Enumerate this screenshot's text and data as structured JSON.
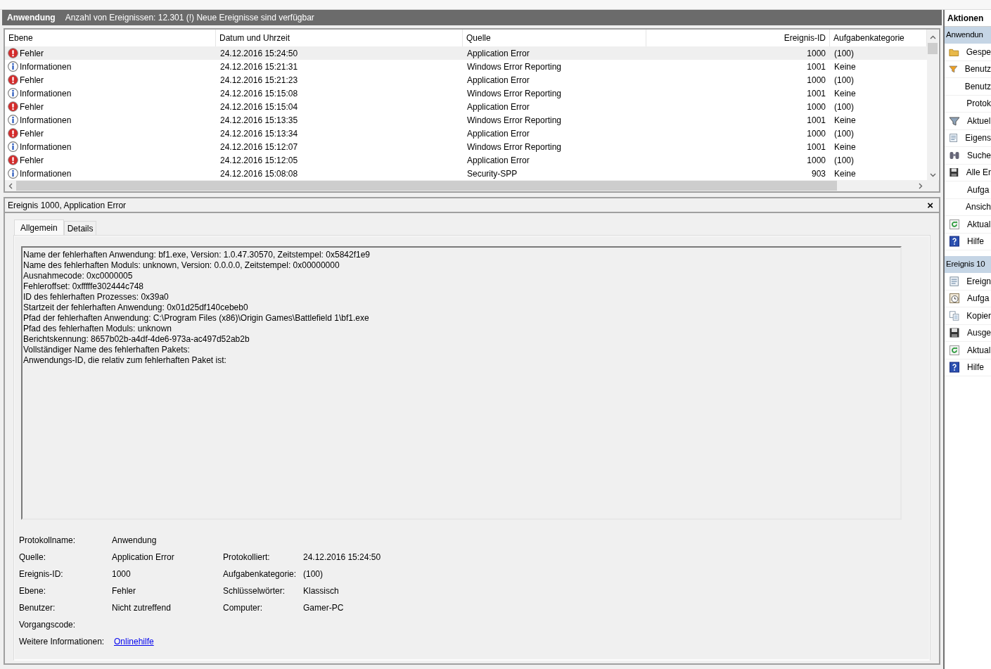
{
  "header": {
    "title": "Anwendung",
    "summary": "Anzahl von Ereignissen: 12.301 (!) Neue Ereignisse sind verfügbar"
  },
  "table": {
    "columns": [
      "Ebene",
      "Datum und Uhrzeit",
      "Quelle",
      "Ereignis-ID",
      "Aufgabenkategorie"
    ],
    "rows": [
      {
        "kind": "error",
        "ebene": "Fehler",
        "datetime": "24.12.2016 15:24:50",
        "source": "Application Error",
        "event_id": "1000",
        "category": "(100)",
        "selected": true
      },
      {
        "kind": "info",
        "ebene": "Informationen",
        "datetime": "24.12.2016 15:21:31",
        "source": "Windows Error Reporting",
        "event_id": "1001",
        "category": "Keine",
        "selected": false
      },
      {
        "kind": "error",
        "ebene": "Fehler",
        "datetime": "24.12.2016 15:21:23",
        "source": "Application Error",
        "event_id": "1000",
        "category": "(100)",
        "selected": false
      },
      {
        "kind": "info",
        "ebene": "Informationen",
        "datetime": "24.12.2016 15:15:08",
        "source": "Windows Error Reporting",
        "event_id": "1001",
        "category": "Keine",
        "selected": false
      },
      {
        "kind": "error",
        "ebene": "Fehler",
        "datetime": "24.12.2016 15:15:04",
        "source": "Application Error",
        "event_id": "1000",
        "category": "(100)",
        "selected": false
      },
      {
        "kind": "info",
        "ebene": "Informationen",
        "datetime": "24.12.2016 15:13:35",
        "source": "Windows Error Reporting",
        "event_id": "1001",
        "category": "Keine",
        "selected": false
      },
      {
        "kind": "error",
        "ebene": "Fehler",
        "datetime": "24.12.2016 15:13:34",
        "source": "Application Error",
        "event_id": "1000",
        "category": "(100)",
        "selected": false
      },
      {
        "kind": "info",
        "ebene": "Informationen",
        "datetime": "24.12.2016 15:12:07",
        "source": "Windows Error Reporting",
        "event_id": "1001",
        "category": "Keine",
        "selected": false
      },
      {
        "kind": "error",
        "ebene": "Fehler",
        "datetime": "24.12.2016 15:12:05",
        "source": "Application Error",
        "event_id": "1000",
        "category": "(100)",
        "selected": false
      },
      {
        "kind": "info",
        "ebene": "Informationen",
        "datetime": "24.12.2016 15:08:08",
        "source": "Security-SPP",
        "event_id": "903",
        "category": "Keine",
        "selected": false
      }
    ]
  },
  "detail": {
    "title": "Ereignis 1000, Application Error",
    "close": "×",
    "tabs": [
      {
        "label": "Allgemein",
        "selected": true
      },
      {
        "label": "Details",
        "selected": false
      }
    ],
    "description": [
      "Name der fehlerhaften Anwendung: bf1.exe, Version: 1.0.47.30570, Zeitstempel: 0x5842f1e9",
      "Name des fehlerhaften Moduls: unknown, Version: 0.0.0.0, Zeitstempel: 0x00000000",
      "Ausnahmecode: 0xc0000005",
      "Fehleroffset: 0xfffffe302444c748",
      "ID des fehlerhaften Prozesses: 0x39a0",
      "Startzeit der fehlerhaften Anwendung: 0x01d25df140cebeb0",
      "Pfad der fehlerhaften Anwendung: C:\\Program Files (x86)\\Origin Games\\Battlefield 1\\bf1.exe",
      "Pfad des fehlerhaften Moduls: unknown",
      "Berichtskennung: 8657b02b-a4df-4de6-973a-ac497d52ab2b",
      "Vollständiger Name des fehlerhaften Pakets:",
      "Anwendungs-ID, die relativ zum fehlerhaften Paket ist:"
    ],
    "properties": [
      {
        "label": "Protokollname:",
        "value": "Anwendung"
      },
      {
        "label": "Quelle:",
        "value": "Application Error",
        "right_label": "Protokolliert:",
        "right_value": "24.12.2016 15:24:50"
      },
      {
        "label": "Ereignis-ID:",
        "value": "1000",
        "right_label": "Aufgabenkategorie:",
        "right_value": "(100)"
      },
      {
        "label": "Ebene:",
        "value": "Fehler",
        "right_label": "Schlüsselwörter:",
        "right_value": "Klassisch"
      },
      {
        "label": "Benutzer:",
        "value": "Nicht zutreffend",
        "right_label": "Computer:",
        "right_value": "Gamer-PC"
      },
      {
        "label": "Vorgangscode:"
      }
    ],
    "more_info": {
      "label": "Weitere Informationen:",
      "link": "Onlinehilfe"
    }
  },
  "actions": {
    "title": "Aktionen",
    "sections": [
      {
        "title": "Anwendun",
        "items": [
          "Gespe",
          "Benutz",
          "Benutz",
          "Protok",
          "Aktuel",
          "Eigens",
          "Suche",
          "Alle Er",
          "Aufga",
          "Ansich",
          "Aktual",
          "Hilfe"
        ]
      },
      {
        "title": "Ereignis 10",
        "items": [
          "Ereign",
          "Aufga",
          "Kopier",
          "Ausge",
          "Aktual",
          "Hilfe"
        ]
      }
    ]
  }
}
